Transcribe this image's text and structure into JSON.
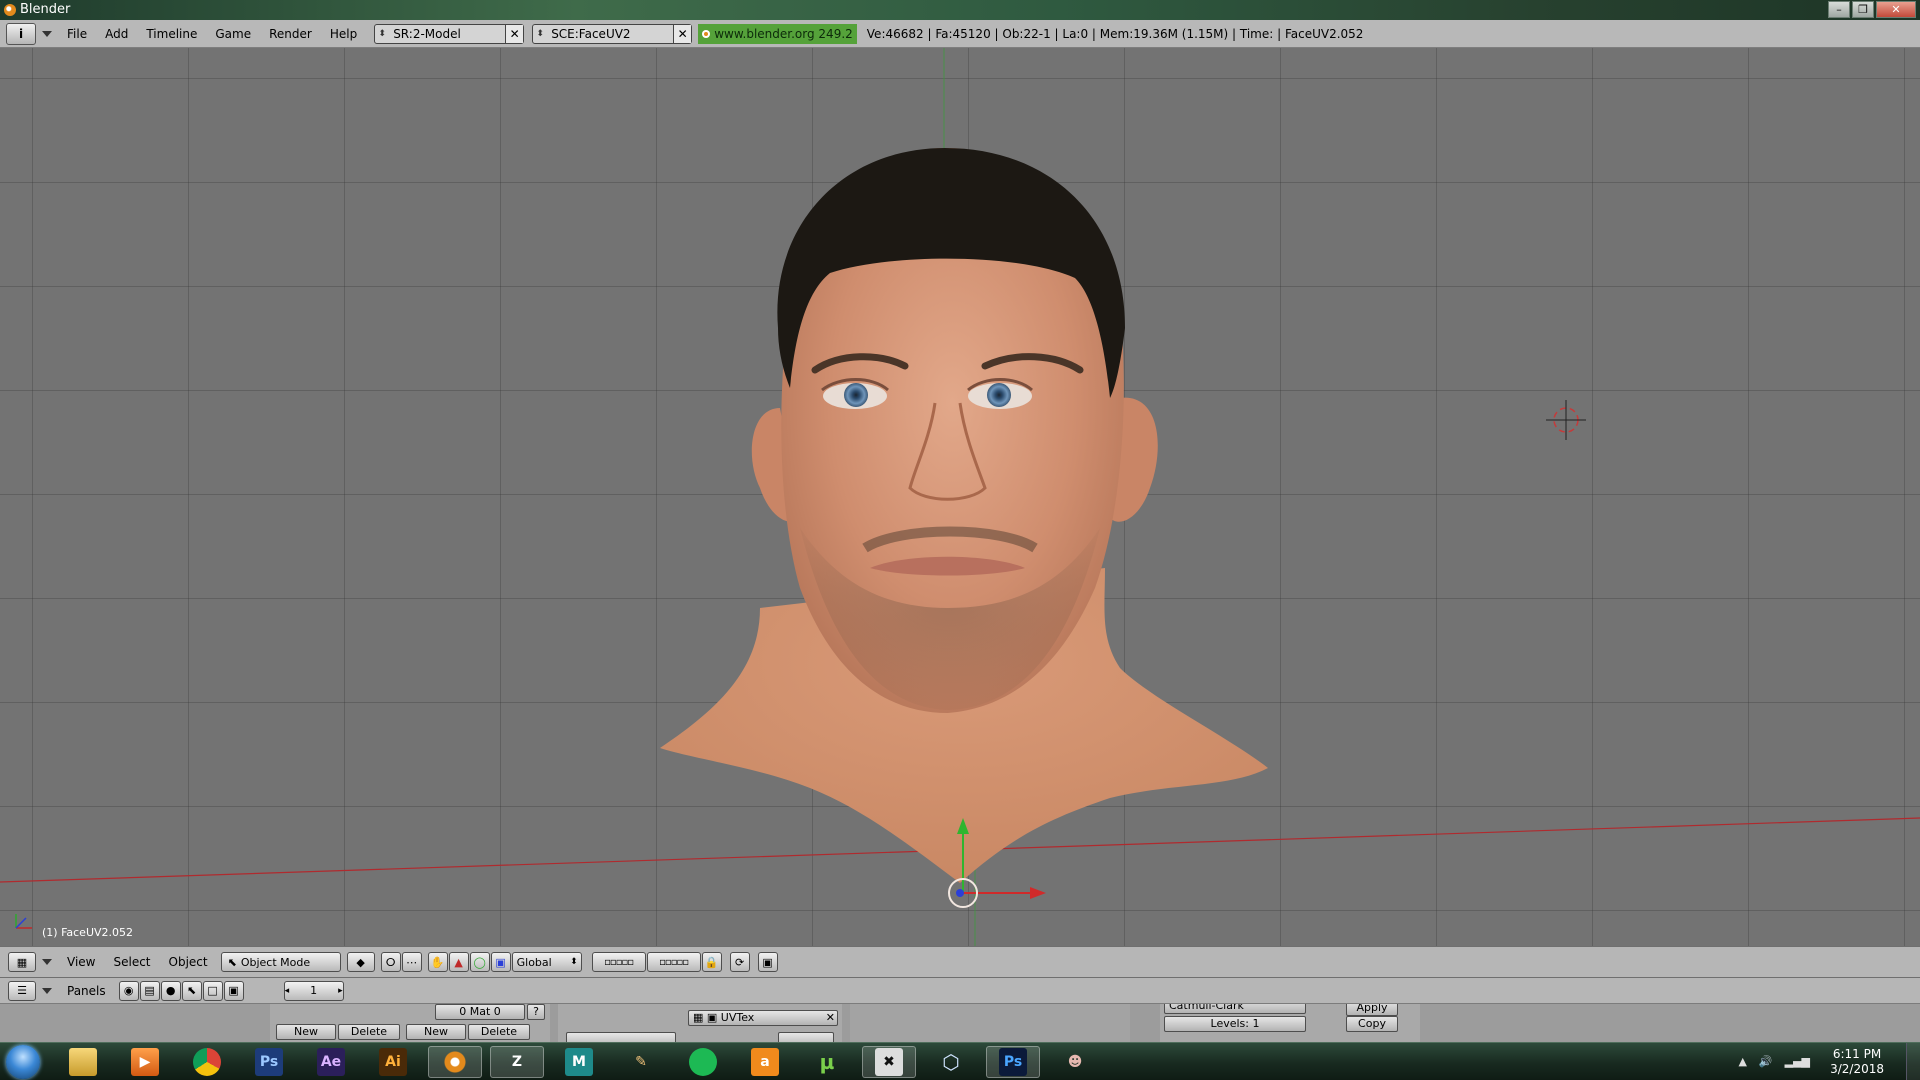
{
  "window": {
    "title": "Blender",
    "controls": [
      "–",
      "❐",
      "✕"
    ]
  },
  "info": {
    "menus": [
      "File",
      "Add",
      "Timeline",
      "Game",
      "Render",
      "Help"
    ],
    "screen": "SR:2-Model",
    "scene": "SCE:FaceUV2",
    "url": "www.blender.org 249.2",
    "stats": "Ve:46682 | Fa:45120 | Ob:22-1 | La:0  | Mem:19.36M (1.15M)  | Time: | FaceUV2.052"
  },
  "viewport": {
    "object_label": "(1) FaceUV2.052"
  },
  "view3d_header": {
    "menus": [
      "View",
      "Select",
      "Object"
    ],
    "mode": "Object Mode",
    "orientation": "Global"
  },
  "buttons": {
    "panels_label": "Panels",
    "frame": "1",
    "material": "0 Mat 0",
    "question": "?",
    "new1": "New",
    "delete1": "Delete",
    "new2": "New",
    "delete2": "Delete",
    "uvtex": "UVTex",
    "subsurf": "Catmull-Clark",
    "levels": "Levels: 1",
    "apply": "Apply",
    "copy": "Copy"
  },
  "taskbar": {
    "apps": [
      {
        "name": "explorer",
        "label": ""
      },
      {
        "name": "media-player",
        "label": "▶"
      },
      {
        "name": "chrome",
        "label": ""
      },
      {
        "name": "photoshop-cs",
        "label": "Ps"
      },
      {
        "name": "after-effects",
        "label": "Ae"
      },
      {
        "name": "illustrator",
        "label": "Ai"
      },
      {
        "name": "blender",
        "label": ""
      },
      {
        "name": "zbrush",
        "label": "Z"
      },
      {
        "name": "maya",
        "label": "M"
      },
      {
        "name": "pencil",
        "label": "✎"
      },
      {
        "name": "spotify",
        "label": ""
      },
      {
        "name": "amazon",
        "label": "a"
      },
      {
        "name": "utorrent",
        "label": "µ"
      },
      {
        "name": "xnormal",
        "label": "✖"
      },
      {
        "name": "3d-box",
        "label": "⬡"
      },
      {
        "name": "photoshop",
        "label": "Ps"
      },
      {
        "name": "game",
        "label": "☻"
      }
    ],
    "clock_time": "6:11 PM",
    "clock_date": "3/2/2018"
  },
  "colors": {
    "viewport_bg": "#737373",
    "ui_gray": "#b8b8b8",
    "x_axis": "#c0282e",
    "y_axis": "#2fa82f",
    "url_green": "#55a23a"
  }
}
